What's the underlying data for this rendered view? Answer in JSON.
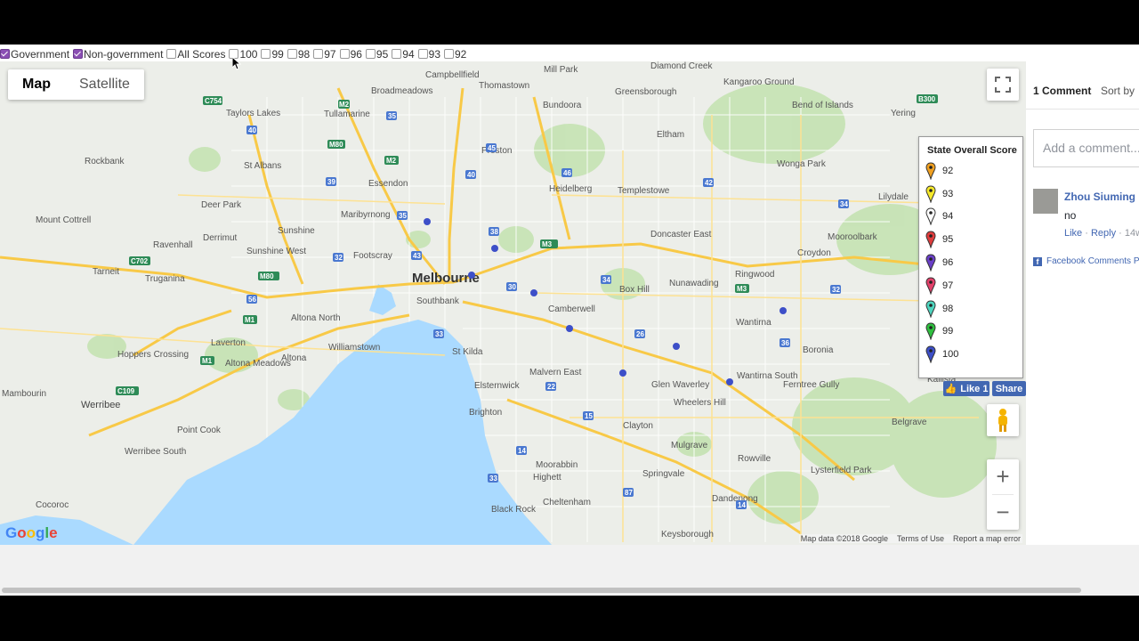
{
  "filters": {
    "government": {
      "label": "Government",
      "checked": true
    },
    "non_government": {
      "label": "Non-government",
      "checked": true
    },
    "all_scores": {
      "label": "All Scores",
      "checked": false
    },
    "scores": [
      "100",
      "99",
      "98",
      "97",
      "96",
      "95",
      "94",
      "93",
      "92"
    ]
  },
  "map": {
    "type_buttons": {
      "map": "Map",
      "satellite": "Satellite",
      "active": "Map"
    },
    "city_label": "Melbourne",
    "attribution": {
      "data": "Map data ©2018 Google",
      "terms": "Terms of Use",
      "report": "Report a map error"
    },
    "logo": "Google",
    "places": [
      {
        "name": "Broadmeadows"
      },
      {
        "name": "Campbellfield"
      },
      {
        "name": "Mill Park"
      },
      {
        "name": "Diamond Creek"
      },
      {
        "name": "Kangaroo Ground"
      },
      {
        "name": "Bend of Islands"
      },
      {
        "name": "Taylors Lakes"
      },
      {
        "name": "Tullamarine"
      },
      {
        "name": "Bundoora"
      },
      {
        "name": "Greensborough"
      },
      {
        "name": "Eltham"
      },
      {
        "name": "Yering"
      },
      {
        "name": "Thomastown"
      },
      {
        "name": "St Albans"
      },
      {
        "name": "Essendon"
      },
      {
        "name": "Preston"
      },
      {
        "name": "Heidelberg"
      },
      {
        "name": "Templestowe"
      },
      {
        "name": "Wonga Park"
      },
      {
        "name": "Rockbank"
      },
      {
        "name": "Deer Park"
      },
      {
        "name": "Maribyrnong"
      },
      {
        "name": "Lilydale"
      },
      {
        "name": "Mount Cottrell"
      },
      {
        "name": "Derrimut"
      },
      {
        "name": "Sunshine"
      },
      {
        "name": "Doncaster East"
      },
      {
        "name": "Mooroolbark"
      },
      {
        "name": "Ravenhall"
      },
      {
        "name": "Sunshine West"
      },
      {
        "name": "Footscray"
      },
      {
        "name": "Croydon"
      },
      {
        "name": "Tarneit"
      },
      {
        "name": "Truganina"
      },
      {
        "name": "Ringwood"
      },
      {
        "name": "Box Hill"
      },
      {
        "name": "Nunawading"
      },
      {
        "name": "Southbank"
      },
      {
        "name": "Camberwell"
      },
      {
        "name": "Altona North"
      },
      {
        "name": "Wantirna"
      },
      {
        "name": "Laverton"
      },
      {
        "name": "Williamstown"
      },
      {
        "name": "Hoppers Crossing"
      },
      {
        "name": "Altona"
      },
      {
        "name": "Altona Meadows"
      },
      {
        "name": "St Kilda"
      },
      {
        "name": "Boronia"
      },
      {
        "name": "Malvern East"
      },
      {
        "name": "Mambourin"
      },
      {
        "name": "Elsternwick"
      },
      {
        "name": "Glen Waverley"
      },
      {
        "name": "Wantirna South"
      },
      {
        "name": "Ferntree Gully"
      },
      {
        "name": "Kallista"
      },
      {
        "name": "Werribee"
      },
      {
        "name": "Brighton"
      },
      {
        "name": "Wheelers Hill"
      },
      {
        "name": "Belgrave"
      },
      {
        "name": "Point Cook"
      },
      {
        "name": "Clayton"
      },
      {
        "name": "Werribee South"
      },
      {
        "name": "Mulgrave"
      },
      {
        "name": "Rowville"
      },
      {
        "name": "Moorabbin"
      },
      {
        "name": "Springvale"
      },
      {
        "name": "Lysterfield Park"
      },
      {
        "name": "Highett"
      },
      {
        "name": "Cocoroc"
      },
      {
        "name": "Cheltenham"
      },
      {
        "name": "Black Rock"
      },
      {
        "name": "Dandenong"
      },
      {
        "name": "Keysborough"
      }
    ]
  },
  "legend": {
    "title": "State Overall Score",
    "items": [
      {
        "score": "92",
        "color": "#f0a020"
      },
      {
        "score": "93",
        "color": "#f6e92a"
      },
      {
        "score": "94",
        "color": "#ffffff"
      },
      {
        "score": "95",
        "color": "#e03c3c"
      },
      {
        "score": "96",
        "color": "#6a3fc8"
      },
      {
        "score": "97",
        "color": "#e2406a"
      },
      {
        "score": "98",
        "color": "#4fd6c0"
      },
      {
        "score": "99",
        "color": "#2fbf3f"
      },
      {
        "score": "100",
        "color": "#3d4fc8"
      }
    ]
  },
  "facebook": {
    "like_label": "Like 1",
    "share_label": "Share"
  },
  "comments": {
    "count_label": "1 Comment",
    "sort_label": "Sort by",
    "add_placeholder": "Add a comment...",
    "items": [
      {
        "author": "Zhou Siuming",
        "text": "no",
        "like": "Like",
        "reply": "Reply",
        "time": "14w"
      }
    ],
    "plugin_label": "Facebook Comments Plugin"
  }
}
